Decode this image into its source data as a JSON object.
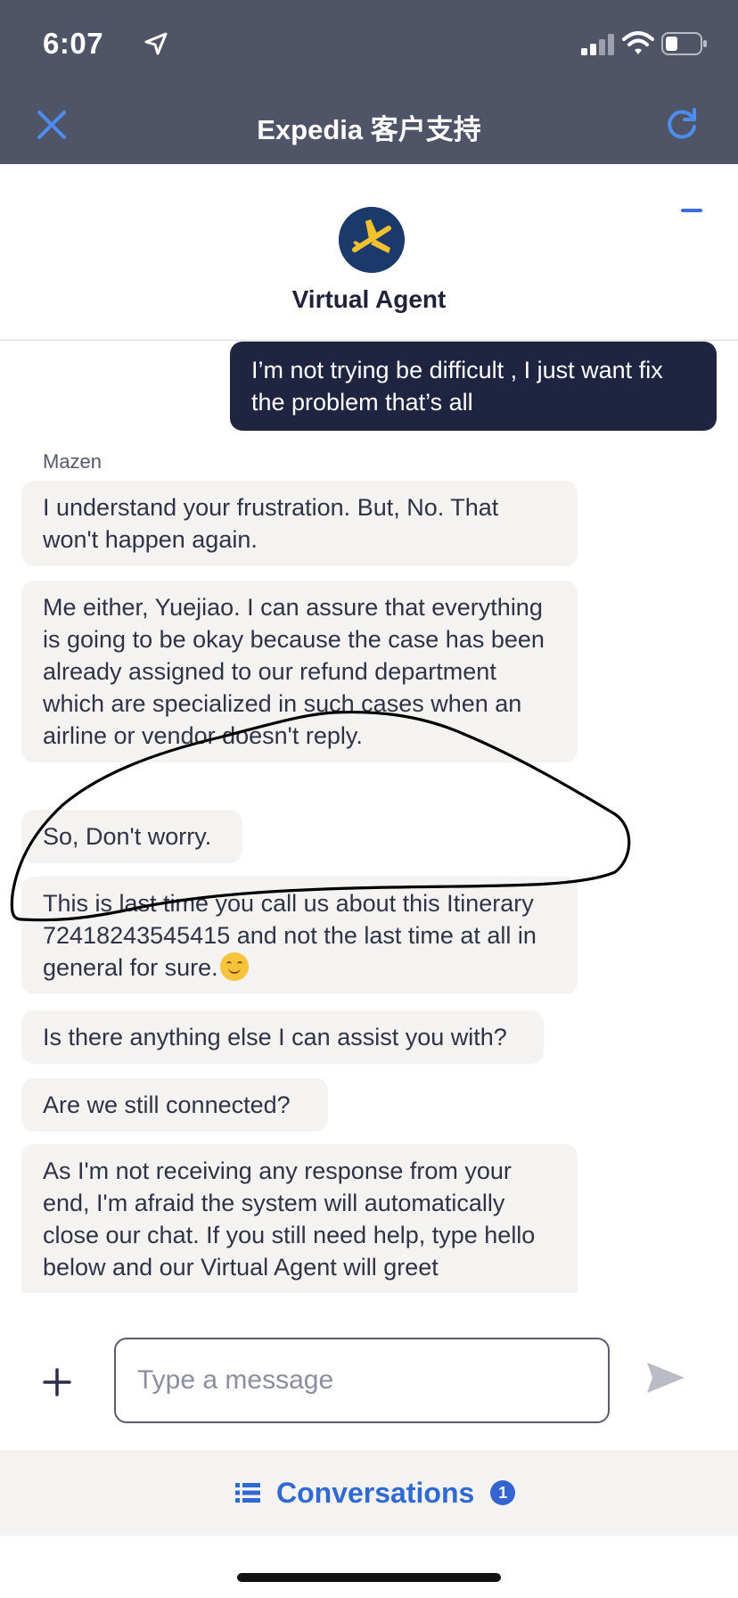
{
  "status_bar": {
    "time": "6:07"
  },
  "header": {
    "title": "Expedia 客户支持"
  },
  "agent": {
    "name": "Virtual Agent"
  },
  "chat": {
    "user_message": "I’m not trying be difficult , I just want fix the problem that’s all",
    "sender": "Mazen",
    "messages": [
      "I understand your frustration. But, No. That won't happen again.",
      "Me either, Yuejiao. I can assure that everything is going to be okay because the case has been already assigned to our refund department which are specialized in such cases when an airline or vendor doesn't reply.",
      "So, Don't worry.",
      "This is last time you call us about this Itinerary 72418243545415 and not the last time at all in general for sure.",
      "Is there anything else I can assist you with?",
      "Are we still connected?",
      "As I'm not receiving any response from your end, I'm afraid the system will automatically close our chat. If you still need help, type hello below and our Virtual Agent will greet"
    ]
  },
  "composer": {
    "placeholder": "Type a message"
  },
  "conversations": {
    "label": "Conversations",
    "badge": "1"
  },
  "colors": {
    "header_bg": "#4f5567",
    "accent": "#3f6fd6",
    "user_bubble": "#1f2540",
    "agent_bubble": "#f4f3f2"
  }
}
